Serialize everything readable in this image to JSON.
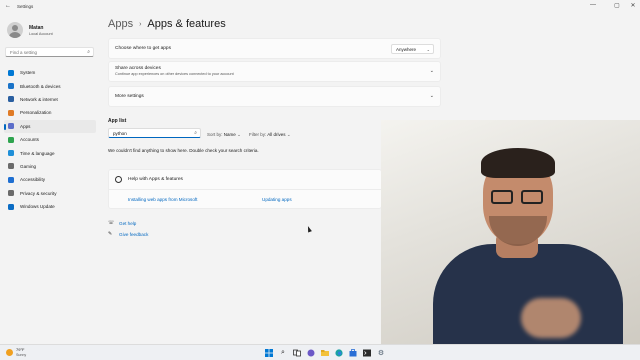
{
  "window": {
    "title": "Settings",
    "back_glyph": "←",
    "minimize_glyph": "—",
    "maximize_glyph": "▢",
    "close_glyph": "✕"
  },
  "user": {
    "name": "Matan",
    "account": "Local Account"
  },
  "sidebar": {
    "search_placeholder": "Find a setting",
    "items": [
      {
        "label": "System",
        "icon": "monitor-icon",
        "color": "#0078d4"
      },
      {
        "label": "Bluetooth & devices",
        "icon": "bluetooth-icon",
        "color": "#1a73c8"
      },
      {
        "label": "Network & internet",
        "icon": "network-icon",
        "color": "#2a5fa0"
      },
      {
        "label": "Personalization",
        "icon": "brush-icon",
        "color": "#e07b26"
      },
      {
        "label": "Apps",
        "icon": "apps-icon",
        "color": "#5b6dc9",
        "active": true
      },
      {
        "label": "Accounts",
        "icon": "person-icon",
        "color": "#2ea44f"
      },
      {
        "label": "Time & language",
        "icon": "globe-clock-icon",
        "color": "#1f8fd8"
      },
      {
        "label": "Gaming",
        "icon": "controller-icon",
        "color": "#6b6b6b"
      },
      {
        "label": "Accessibility",
        "icon": "accessibility-icon",
        "color": "#1f6fd1"
      },
      {
        "label": "Privacy & security",
        "icon": "shield-icon",
        "color": "#6a6a6a"
      },
      {
        "label": "Windows Update",
        "icon": "update-icon",
        "color": "#0a6cc4"
      }
    ]
  },
  "breadcrumb": {
    "parent": "Apps",
    "separator": "›",
    "current": "Apps & features"
  },
  "cards": {
    "get_apps": {
      "label": "Choose where to get apps",
      "value": "Anywhere"
    },
    "share": {
      "label": "Share across devices",
      "sub": "Continue app experiences on other devices connected to your account"
    },
    "more": {
      "label": "More settings"
    }
  },
  "app_list": {
    "title": "App list",
    "search_value": "python",
    "sort_label": "Sort by:",
    "sort_value": "Name",
    "filter_label": "Filter by:",
    "filter_value": "All drives",
    "empty_message": "We couldn't find anything to show here. Double check your search criteria."
  },
  "help": {
    "title": "Help with Apps & features",
    "link1": "Installing web apps from Microsoft",
    "link2": "Updating apps"
  },
  "footer_links": {
    "get_help": "Get help",
    "feedback": "Give feedback"
  },
  "taskbar": {
    "weather_temp": "79°F",
    "weather_cond": "Sunny",
    "apps": [
      "windows-start-icon",
      "search-icon",
      "task-view-icon",
      "chat-icon",
      "file-explorer-icon",
      "edge-icon",
      "store-icon",
      "terminal-icon",
      "settings-icon"
    ]
  }
}
